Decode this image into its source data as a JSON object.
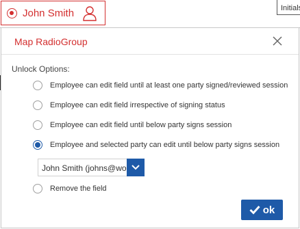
{
  "background": {
    "column_header": "Initials"
  },
  "field_chip": {
    "name": "John Smith",
    "icons": [
      "radio-selected-icon",
      "user-outline-icon"
    ]
  },
  "dialog": {
    "title": "Map RadioGroup",
    "close_icon": "close-icon",
    "unlock_label": "Unlock Options:",
    "options": [
      {
        "label": "Employee can edit field until at least one party signed/reviewed session",
        "selected": false
      },
      {
        "label": "Employee can edit field irrespective of signing status",
        "selected": false
      },
      {
        "label": "Employee can edit field until below party signs session",
        "selected": false
      },
      {
        "label": "Employee and selected party can edit until below party signs session",
        "selected": true
      },
      {
        "label": "Remove the field",
        "selected": false
      }
    ],
    "party_select": {
      "value": "John Smith (johns@wo",
      "arrow_icon": "chevron-down-icon"
    },
    "ok_button": {
      "label": "ok",
      "icon": "check-icon"
    }
  },
  "colors": {
    "accent_red": "#d32f2f",
    "primary_blue": "#1e5aa8"
  }
}
